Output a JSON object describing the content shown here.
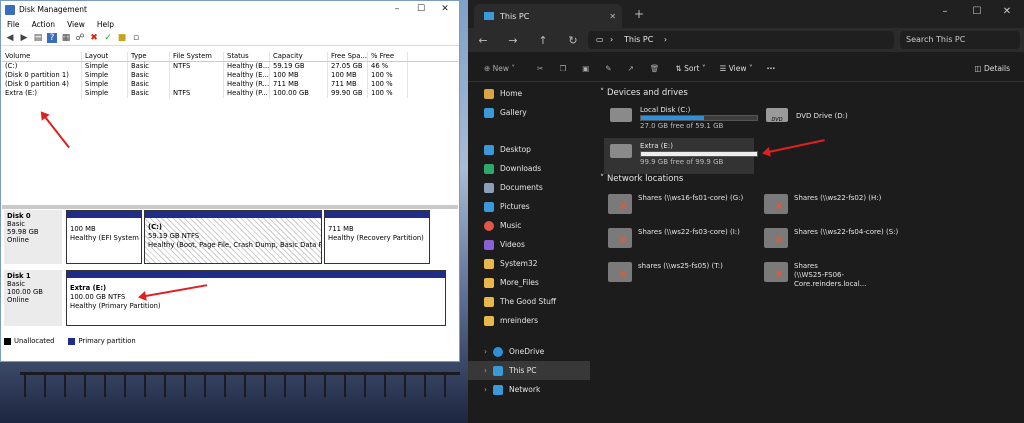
{
  "dm": {
    "title": "Disk Management",
    "menu": [
      "File",
      "Action",
      "View",
      "Help"
    ],
    "columns": [
      "Volume",
      "Layout",
      "Type",
      "File System",
      "Status",
      "Capacity",
      "Free Spa...",
      "% Free"
    ],
    "rows": [
      [
        "(C:)",
        "Simple",
        "Basic",
        "NTFS",
        "Healthy (B...",
        "59.19 GB",
        "27.05 GB",
        "46 %"
      ],
      [
        "(Disk 0 partition 1)",
        "Simple",
        "Basic",
        "",
        "Healthy (E...",
        "100 MB",
        "100 MB",
        "100 %"
      ],
      [
        "(Disk 0 partition 4)",
        "Simple",
        "Basic",
        "",
        "Healthy (R...",
        "711 MB",
        "711 MB",
        "100 %"
      ],
      [
        "Extra (E:)",
        "Simple",
        "Basic",
        "NTFS",
        "Healthy (P...",
        "100.00 GB",
        "99.90 GB",
        "100 %"
      ]
    ],
    "disk0": {
      "name": "Disk 0",
      "type": "Basic",
      "size": "59.98 GB",
      "state": "Online",
      "p1": [
        "100 MB",
        "Healthy (EFI System"
      ],
      "p2": [
        "(C:)",
        "59.19 GB NTFS",
        "Healthy (Boot, Page File, Crash Dump, Basic Data Part"
      ],
      "p3": [
        "711 MB",
        "Healthy (Recovery Partition)"
      ]
    },
    "disk1": {
      "name": "Disk 1",
      "type": "Basic",
      "size": "100.00 GB",
      "state": "Online",
      "p1": [
        "Extra  (E:)",
        "100.00 GB NTFS",
        "Healthy (Primary Partition)"
      ]
    },
    "legend": [
      "Unallocated",
      "Primary partition"
    ]
  },
  "ex": {
    "tab": "This PC",
    "address": "This PC",
    "search": "Search This PC",
    "cmd": {
      "new": "New",
      "sort": "Sort",
      "view": "View",
      "details": "Details"
    },
    "sidebar": [
      "Home",
      "Gallery",
      "Desktop",
      "Downloads",
      "Documents",
      "Pictures",
      "Music",
      "Videos",
      "System32",
      "More_Files",
      "The Good Stuff",
      "mreinders",
      "OneDrive",
      "This PC",
      "Network"
    ],
    "devices_header": "Devices and drives",
    "drives": [
      {
        "name": "Local Disk (C:)",
        "free": "27.0 GB free of 59.1 GB",
        "used_fraction": 0.54
      },
      {
        "name": "DVD Drive (D:)"
      },
      {
        "name": "Extra (E:)",
        "free": "99.9 GB free of 99.9 GB",
        "used_fraction": 0.0
      }
    ],
    "dvd_label": "DVD",
    "network_header": "Network locations",
    "network": [
      "Shares (\\\\ws16-fs01-core) (G:)",
      "Shares (\\\\ws22-fs02) (H:)",
      "Shares (\\\\ws22-fs03-core) (I:)",
      "Shares (\\\\ws22-fs04-core) (S:)",
      "shares (\\\\ws25-fs05) (T:)",
      "Shares",
      "(\\\\WS25-FS06-Core.reinders.local..."
    ]
  }
}
